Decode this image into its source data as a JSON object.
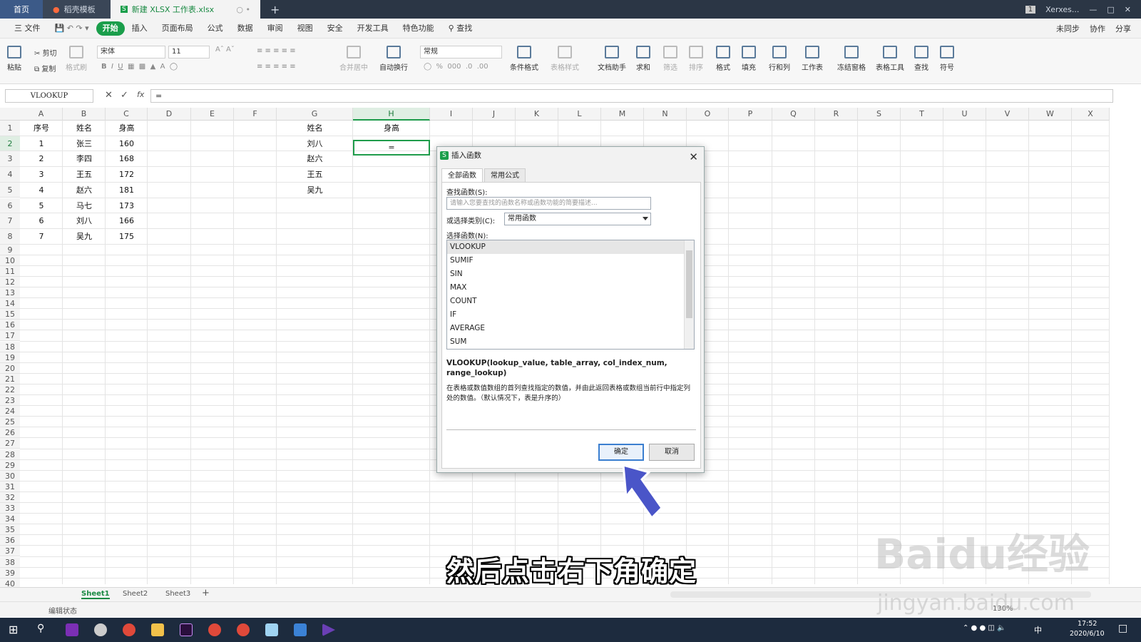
{
  "titlebar": {
    "tabs": [
      "首页",
      "稻壳模板",
      "新建 XLSX 工作表.xlsx"
    ],
    "user": "Xerxes...",
    "badge": "1"
  },
  "menubar": {
    "file": "三 文件",
    "items": [
      "开始",
      "插入",
      "页面布局",
      "公式",
      "数据",
      "审阅",
      "视图",
      "安全",
      "开发工具",
      "特色功能"
    ],
    "search": "查找",
    "right": [
      "未同步",
      "协作",
      "分享"
    ]
  },
  "ribbon": {
    "cut": "剪切",
    "copy": "复制",
    "paste": "粘贴",
    "format_painter": "格式刷",
    "font": "宋体",
    "size": "11",
    "number_format": "常规",
    "merge": "合并居中",
    "wrap": "自动换行",
    "buttons": [
      "条件格式",
      "表格样式",
      "文档助手",
      "求和",
      "筛选",
      "排序",
      "格式",
      "填充",
      "行和列",
      "工作表",
      "冻结窗格",
      "表格工具",
      "查找",
      "符号"
    ]
  },
  "formula_bar": {
    "name_box": "VLOOKUP",
    "fx": "fx",
    "formula": "="
  },
  "columns": [
    "A",
    "B",
    "C",
    "D",
    "E",
    "F",
    "G",
    "H",
    "I",
    "J",
    "K",
    "L",
    "M",
    "N",
    "O",
    "P",
    "Q",
    "R",
    "S",
    "T",
    "U",
    "V",
    "W",
    "X"
  ],
  "rows": [
    "1",
    "2",
    "3",
    "4",
    "5",
    "6",
    "7",
    "8",
    "9",
    "10",
    "11",
    "12",
    "13",
    "14",
    "15",
    "16",
    "17",
    "18",
    "19",
    "20",
    "21",
    "22",
    "23",
    "24",
    "25",
    "26",
    "27",
    "28",
    "29",
    "30",
    "31",
    "32",
    "33",
    "34",
    "35",
    "36",
    "37",
    "38",
    "39",
    "40"
  ],
  "table1": {
    "headers": [
      "序号",
      "姓名",
      "身高"
    ],
    "rows": [
      [
        "1",
        "张三",
        "160"
      ],
      [
        "2",
        "李四",
        "168"
      ],
      [
        "3",
        "王五",
        "172"
      ],
      [
        "4",
        "赵六",
        "181"
      ],
      [
        "5",
        "马七",
        "173"
      ],
      [
        "6",
        "刘八",
        "166"
      ],
      [
        "7",
        "吴九",
        "175"
      ]
    ]
  },
  "table2": {
    "headers": [
      "姓名",
      "身高"
    ],
    "names": [
      "刘八",
      "赵六",
      "王五",
      "吴九"
    ],
    "active_value": "="
  },
  "sheets": [
    "Sheet1",
    "Sheet2",
    "Sheet3"
  ],
  "status": "编辑状态",
  "zoom": "130%",
  "clock": {
    "time": "17:52",
    "date": "2020/6/10"
  },
  "tray_ime": "中",
  "dialog": {
    "title": "插入函数",
    "tabs": [
      "全部函数",
      "常用公式"
    ],
    "search_label": "查找函数(S):",
    "search_placeholder": "请输入您要查找的函数名称或函数功能的简要描述...",
    "category_label": "或选择类别(C):",
    "category": "常用函数",
    "list_label": "选择函数(N):",
    "functions": [
      "VLOOKUP",
      "SUMIF",
      "SIN",
      "MAX",
      "COUNT",
      "IF",
      "AVERAGE",
      "SUM"
    ],
    "signature": "VLOOKUP(lookup_value, table_array, col_index_num, range_lookup)",
    "description": "在表格或数值数组的首列查找指定的数值，并由此返回表格或数组当前行中指定列处的数值。（默认情况下，表是升序的）",
    "ok": "确定",
    "cancel": "取消"
  },
  "subtitle": "然后点击右下角确定",
  "watermark": "Baidu经验",
  "watermark_url": "jingyan.baidu.com"
}
